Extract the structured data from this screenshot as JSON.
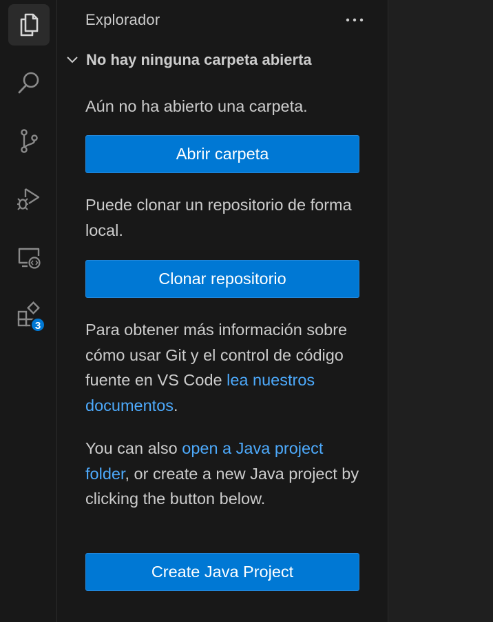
{
  "activity_bar": {
    "items": [
      {
        "name": "explorer",
        "icon": "files-icon",
        "active": true
      },
      {
        "name": "search",
        "icon": "search-icon"
      },
      {
        "name": "source-control",
        "icon": "source-control-icon"
      },
      {
        "name": "run-debug",
        "icon": "run-debug-icon"
      },
      {
        "name": "remote-explorer",
        "icon": "remote-explorer-icon"
      },
      {
        "name": "extensions",
        "icon": "extensions-icon",
        "badge": "3"
      }
    ]
  },
  "sidebar": {
    "title": "Explorador",
    "more_icon": "ellipsis-icon",
    "section": {
      "header": "No hay ninguna carpeta abierta",
      "expanded": true,
      "no_folder_text": "Aún no ha abierto una carpeta.",
      "open_folder_button": "Abrir carpeta",
      "clone_text": "Puede clonar un repositorio de forma local.",
      "clone_button": "Clonar repositorio",
      "git_info_text": "Para obtener más información sobre cómo usar Git y el control de código fuente en VS Code ",
      "git_info_link": "lea nuestros documentos",
      "git_info_end": ".",
      "java_text_start": "You can also ",
      "java_link": "open a Java project folder",
      "java_text_end": ", or create a new Java project by clicking the button below.",
      "java_button": "Create Java Project"
    }
  },
  "colors": {
    "accent": "#0078d4",
    "link": "#4daafc",
    "text": "#cccccc",
    "background": "#181818"
  }
}
